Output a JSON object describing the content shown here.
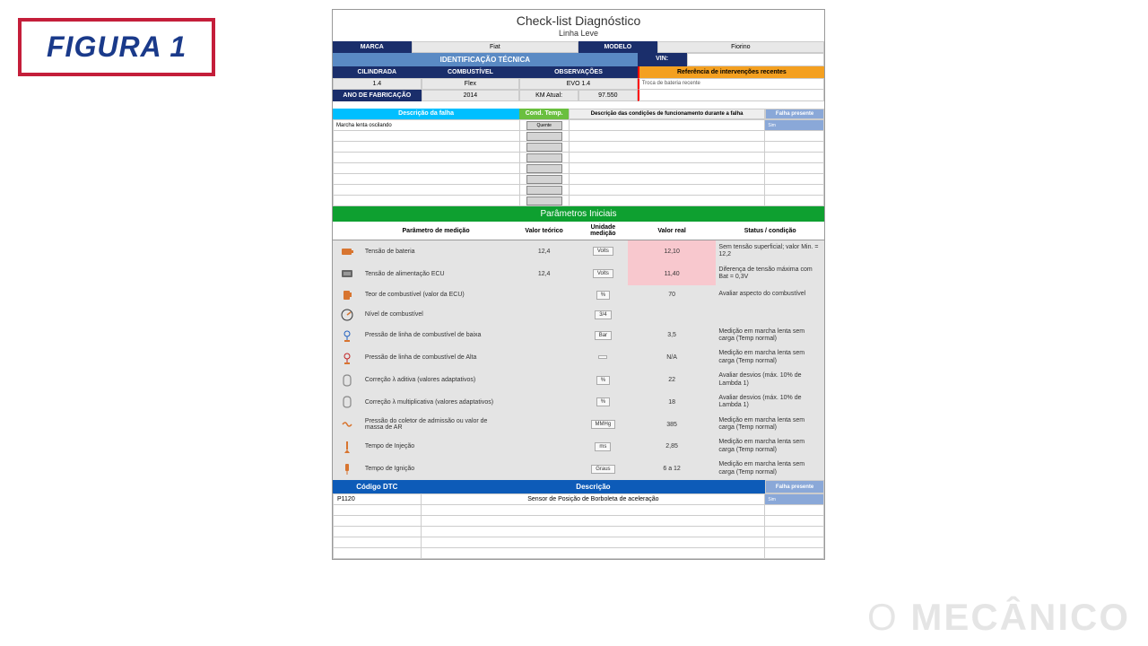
{
  "badge": "FIGURA 1",
  "watermark": {
    "o": "O",
    "m": "MECÂNICO"
  },
  "header": {
    "title": "Check-list Diagnóstico",
    "subtitle": "Linha Leve"
  },
  "top": {
    "marca_label": "MARCA",
    "marca": "Fiat",
    "modelo_label": "MODELO",
    "modelo": "Fiorino"
  },
  "ident": {
    "title": "IDENTIFICAÇÃO TÉCNICA",
    "vin_label": "VIN:",
    "cilindrada_label": "CILINDRADA",
    "combustivel_label": "COMBUSTÍVEL",
    "obs_label": "OBSERVAÇÕES",
    "cilindrada": "1.4",
    "combustivel": "Flex",
    "obs": "EVO 1.4",
    "ano_label": "ANO DE FABRICAÇÃO",
    "ano": "2014",
    "km_label": "KM Atual:",
    "km": "97.550",
    "interv_label": "Referência de intervenções recentes",
    "interv": "Troca de bateria recente"
  },
  "falha": {
    "desc_label": "Descrição da falha",
    "cond_label": "Cond. Temp.",
    "cond_val": "Quente",
    "desc2_label": "Descrição das condições de funcionamento durante a falha",
    "presente_label": "Falha presente",
    "rows": [
      {
        "desc": "Marcha lenta oscilando",
        "presente": "Sim"
      },
      {
        "desc": ""
      },
      {
        "desc": ""
      },
      {
        "desc": ""
      },
      {
        "desc": ""
      },
      {
        "desc": ""
      },
      {
        "desc": ""
      },
      {
        "desc": ""
      }
    ]
  },
  "params": {
    "title": "Parâmetros Iniciais",
    "headers": {
      "param": "Parâmetro de medição",
      "teorico": "Valor teórico",
      "unidade": "Unidade medição",
      "real": "Valor real",
      "status": "Status / condição"
    },
    "rows": [
      {
        "icon": "battery",
        "param": "Tensão de bateria",
        "teorico": "12,4",
        "unidade": "Volts",
        "real": "12,10",
        "pink": true,
        "status": "Sem tensão superficial; valor Min. = 12,2"
      },
      {
        "icon": "ecu",
        "param": "Tensão de alimentação ECU",
        "teorico": "12,4",
        "unidade": "Volts",
        "real": "11,40",
        "pink": true,
        "status": "Diferença de tensão máxima com Bat = 0,3V"
      },
      {
        "icon": "pump",
        "param": "Teor de combustível (valor da ECU)",
        "teorico": "",
        "unidade": "%",
        "real": "70",
        "status": "Avaliar aspecto do combustível"
      },
      {
        "icon": "gauge",
        "param": "Nível de combustível",
        "teorico": "",
        "unidade": "3/4",
        "real": "",
        "status": ""
      },
      {
        "icon": "press-low",
        "param": "Pressão de linha de combustível de baixa",
        "teorico": "",
        "unidade": "Bar",
        "real": "3,5",
        "status": "Medição em marcha lenta sem carga (Temp normal)"
      },
      {
        "icon": "press-high",
        "param": "Pressão de linha de combustível de Alta",
        "teorico": "",
        "unidade": "",
        "real": "N/A",
        "status": "Medição em marcha lenta sem carga (Temp normal)"
      },
      {
        "icon": "lambda",
        "param": "Correção λ aditiva (valores adaptativos)",
        "teorico": "",
        "unidade": "%",
        "real": "22",
        "status": "Avaliar desvios (máx. 10% de Lambda 1)"
      },
      {
        "icon": "lambda",
        "param": "Correção λ multiplicativa (valores adaptativos)",
        "teorico": "",
        "unidade": "%",
        "real": "18",
        "status": "Avaliar desvios (máx. 10% de Lambda 1)"
      },
      {
        "icon": "maf",
        "param": "Pressão do coletor de admissão ou valor de massa de AR",
        "teorico": "",
        "unidade": "MMHg",
        "real": "385",
        "status": "Medição em marcha lenta sem carga (Temp normal)"
      },
      {
        "icon": "inject",
        "param": "Tempo de Injeção",
        "teorico": "",
        "unidade": "ms",
        "real": "2,85",
        "status": "Medição em marcha lenta sem carga (Temp normal)"
      },
      {
        "icon": "spark",
        "param": "Tempo de Ignição",
        "teorico": "",
        "unidade": "Graus",
        "real": "6  a 12",
        "status": "Medição em marcha lenta sem carga (Temp normal)"
      }
    ]
  },
  "dtc": {
    "codigo_label": "Código DTC",
    "desc_label": "Descrição",
    "presente_label": "Falha presente",
    "rows": [
      {
        "codigo": "P1120",
        "desc": "Sensor de Posição de Borboleta de aceleração",
        "presente": "Sim"
      },
      {
        "codigo": "",
        "desc": ""
      },
      {
        "codigo": "",
        "desc": ""
      },
      {
        "codigo": "",
        "desc": ""
      },
      {
        "codigo": "",
        "desc": ""
      },
      {
        "codigo": "",
        "desc": ""
      }
    ]
  }
}
